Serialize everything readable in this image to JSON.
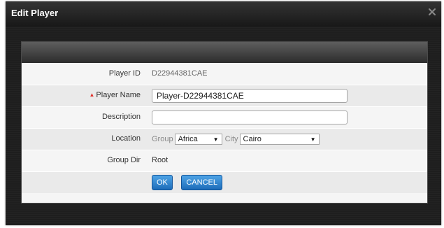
{
  "dialog": {
    "title": "Edit Player",
    "close_icon": "close-icon"
  },
  "form": {
    "player_id": {
      "label": "Player ID",
      "value": "D22944381CAE"
    },
    "player_name": {
      "label": "Player Name",
      "required_marker": "▲",
      "value": "Player-D22944381CAE"
    },
    "description": {
      "label": "Description",
      "value": ""
    },
    "location": {
      "label": "Location",
      "group_label": "Group",
      "group_value": "Africa",
      "city_label": "City",
      "city_value": "Cairo"
    },
    "group_dir": {
      "label": "Group Dir",
      "value": "Root"
    }
  },
  "buttons": {
    "ok": "OK",
    "cancel": "CANCEL"
  },
  "colors": {
    "dialog_bg": "#1e1e1e",
    "panel_bg": "#f5f5f5",
    "accent": "#1d6cb9",
    "required": "#e0302a"
  }
}
